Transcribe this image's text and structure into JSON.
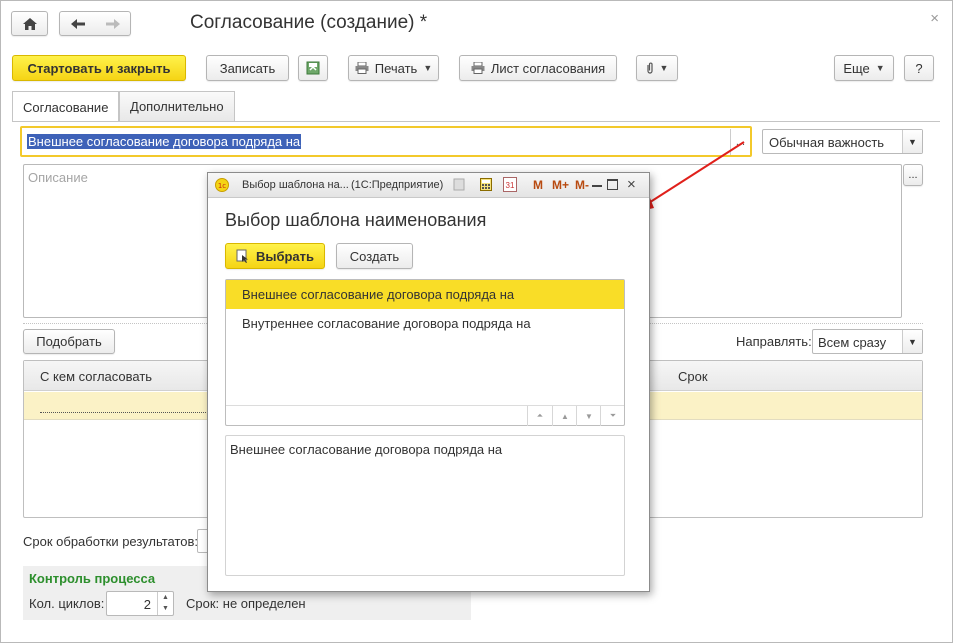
{
  "window": {
    "title": "Согласование (создание) *",
    "close_glyph": "×"
  },
  "toolbar": {
    "start_close_label": "Стартовать и закрыть",
    "save_label": "Записать",
    "print_label": "Печать",
    "approval_sheet_label": "Лист согласования",
    "more_label": "Еще",
    "help_label": "?"
  },
  "tabs": [
    {
      "label": "Согласование",
      "active": true
    },
    {
      "label": "Дополнительно",
      "active": false
    }
  ],
  "form": {
    "name_value": "Внешнее согласование договора подряда на",
    "importance_value": "Обычная важность",
    "description_placeholder": "Описание",
    "pick_button_label": "Подобрать",
    "send_label": "Направлять:",
    "send_value": "Всем сразу",
    "table_headers": [
      "С кем согласовать",
      "Срок"
    ],
    "processing_label": "Срок обработки результатов:",
    "process_control_title": "Контроль процесса",
    "cycles_label": "Кол. циклов:",
    "cycles_value": "2",
    "deadline_text": "Срок: не определен"
  },
  "dialog": {
    "titlebar_text": "Выбор шаблона на...",
    "titlebar_app": "(1С:Предприятие)",
    "heading": "Выбор шаблона наименования",
    "select_label": "Выбрать",
    "create_label": "Создать",
    "list_items": [
      {
        "label": "Внешнее согласование договора подряда на",
        "selected": true
      },
      {
        "label": "Внутреннее согласование договора подряда на",
        "selected": false
      }
    ],
    "preview_text": "Внешнее согласование договора подряда на",
    "m_labels": [
      "M",
      "M+",
      "M-"
    ],
    "calendar_day": "31"
  },
  "colors": {
    "accent_yellow": "#f5d415",
    "selection_blue": "#3e62b8",
    "arrow_red": "#e0201b",
    "group_green": "#2d8f2d"
  },
  "icons": [
    "home-icon",
    "back-arrow-icon",
    "forward-arrow-icon",
    "close-icon",
    "save-icon",
    "printer-icon",
    "paperclip-icon",
    "chevron-down-icon",
    "app-logo-icon",
    "calculator-icon",
    "calendar-icon",
    "minimize-icon",
    "maximize-icon",
    "select-icon",
    "move-first-icon",
    "move-up-icon",
    "move-down-icon",
    "move-last-icon"
  ]
}
